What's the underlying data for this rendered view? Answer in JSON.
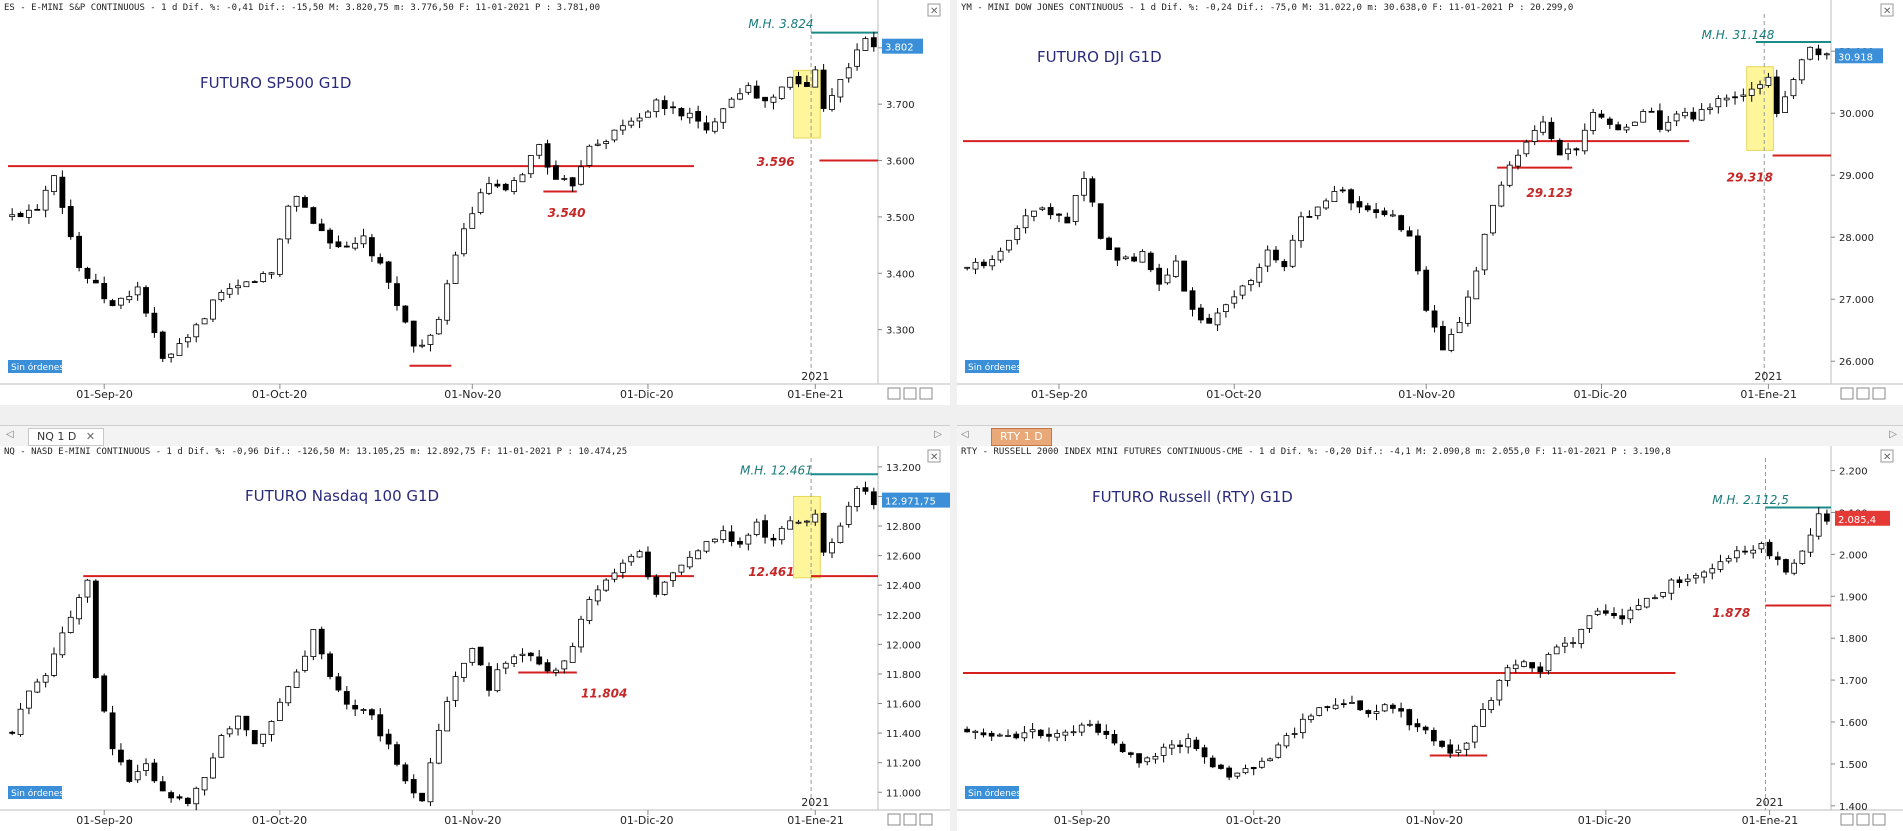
{
  "tabs": {
    "left_tab": "NQ 1 D",
    "right_tab": "RTY 1 D"
  },
  "colors": {
    "up": "#ffffff",
    "down": "#000000",
    "red_line": "#d62020",
    "teal_line": "#1a8a8a",
    "label_red": "#c62828",
    "label_teal": "#1a7a7a",
    "title_blue": "#2a2a7a",
    "price_tag": "#3a8fd8",
    "price_tag_red": "#e53935",
    "highlight": "#fff59a"
  },
  "no_orders_label": "Sin órdenes",
  "chart_data": [
    {
      "id": "sp500",
      "type": "candlestick",
      "header": "ES - E-MINI S&P CONTINUOUS - 1 d Dif. %: -0,41 Dif.: -15,50 M: 3.820,75 m: 3.776,50 F: 11-01-2021 P : 3.781,00",
      "title": "FUTURO SP500 G1D",
      "ylim": [
        3200,
        3860
      ],
      "yticks": [
        3300,
        3400,
        3500,
        3600,
        3700,
        3800
      ],
      "ytick_labels": [
        "3.300",
        "3.400",
        "3.500",
        "3.600",
        "3.700",
        "3.800"
      ],
      "last_price": 3802,
      "last_price_label": "3.802",
      "xlabels": [
        {
          "d": 11,
          "t": "01-Sep-20"
        },
        {
          "d": 32,
          "t": "01-Oct-20"
        },
        {
          "d": 55,
          "t": "01-Nov-20"
        },
        {
          "d": 76,
          "t": "01-Dic-20"
        },
        {
          "d": 96,
          "t": "01-Ene-21"
        }
      ],
      "year_label": {
        "d": 96,
        "t": "2021"
      },
      "n_days": 104,
      "anchors": [
        [
          0,
          3500
        ],
        [
          3,
          3520
        ],
        [
          5,
          3580
        ],
        [
          8,
          3410
        ],
        [
          12,
          3340
        ],
        [
          15,
          3375
        ],
        [
          18,
          3245
        ],
        [
          21,
          3280
        ],
        [
          24,
          3350
        ],
        [
          29,
          3390
        ],
        [
          31,
          3400
        ],
        [
          33,
          3520
        ],
        [
          34,
          3540
        ],
        [
          36,
          3490
        ],
        [
          38,
          3460
        ],
        [
          40,
          3440
        ],
        [
          42,
          3460
        ],
        [
          44,
          3410
        ],
        [
          46,
          3350
        ],
        [
          48,
          3270
        ],
        [
          50,
          3290
        ],
        [
          51,
          3310
        ],
        [
          53,
          3440
        ],
        [
          55,
          3510
        ],
        [
          57,
          3560
        ],
        [
          59,
          3540
        ],
        [
          61,
          3580
        ],
        [
          63,
          3630
        ],
        [
          65,
          3560
        ],
        [
          67,
          3560
        ],
        [
          69,
          3630
        ],
        [
          71,
          3640
        ],
        [
          73,
          3660
        ],
        [
          75,
          3680
        ],
        [
          77,
          3700
        ],
        [
          79,
          3690
        ],
        [
          81,
          3680
        ],
        [
          83,
          3650
        ],
        [
          85,
          3700
        ],
        [
          86,
          3710
        ],
        [
          88,
          3740
        ],
        [
          89,
          3705
        ],
        [
          91,
          3710
        ],
        [
          93,
          3745
        ],
        [
          95,
          3730
        ],
        [
          96,
          3760
        ],
        [
          97,
          3700
        ],
        [
          99,
          3740
        ],
        [
          101,
          3800
        ],
        [
          102,
          3810
        ],
        [
          103,
          3802
        ]
      ],
      "hlines": [
        {
          "y": 3590,
          "from": 0,
          "to": 82,
          "color": "red"
        },
        {
          "y": 3236,
          "from": 48,
          "to": 53,
          "color": "red"
        },
        {
          "y": 3545,
          "from": 64,
          "to": 68,
          "color": "red"
        },
        {
          "y": 3600,
          "from": 97,
          "to": 104,
          "color": "red"
        },
        {
          "y": 3827,
          "from": 96,
          "to": 104,
          "color": "teal"
        }
      ],
      "labels": [
        {
          "t": "M.H. 3.824",
          "d": 88,
          "y": 3835,
          "color": "teal"
        },
        {
          "t": "3.596",
          "d": 89,
          "y": 3590,
          "color": "red"
        },
        {
          "t": "3.540",
          "d": 64,
          "y": 3500,
          "color": "red"
        }
      ],
      "highlight": {
        "from": 94,
        "to": 96,
        "y0": 3640,
        "y1": 3760
      },
      "dashed_x": 95.5
    },
    {
      "id": "dji",
      "type": "candlestick",
      "header": "YM - MINI DOW JONES CONTINUOUS - 1 d Dif. %: -0,24 Dif.: -75,0 M: 31.022,0 m: 30.638,0 F: 11-01-2021 P : 20.299,0",
      "title": "FUTURO DJI G1D",
      "ylim": [
        25600,
        31600
      ],
      "yticks": [
        26000,
        27000,
        28000,
        29000,
        30000,
        31000
      ],
      "ytick_labels": [
        "26.000",
        "27.000",
        "28.000",
        "29.000",
        "30.000",
        "31.000"
      ],
      "last_price": 30918,
      "last_price_label": "30.918",
      "xlabels": [
        {
          "d": 11,
          "t": "01-Sep-20"
        },
        {
          "d": 32,
          "t": "01-Oct-20"
        },
        {
          "d": 55,
          "t": "01-Nov-20"
        },
        {
          "d": 76,
          "t": "01-Dic-20"
        },
        {
          "d": 96,
          "t": "01-Ene-21"
        }
      ],
      "year_label": {
        "d": 96,
        "t": "2021"
      },
      "n_days": 104,
      "anchors": [
        [
          0,
          27500
        ],
        [
          3,
          27600
        ],
        [
          6,
          28200
        ],
        [
          9,
          28500
        ],
        [
          12,
          28300
        ],
        [
          14,
          29000
        ],
        [
          16,
          28000
        ],
        [
          18,
          27600
        ],
        [
          21,
          27700
        ],
        [
          23,
          27200
        ],
        [
          25,
          27600
        ],
        [
          27,
          26800
        ],
        [
          29,
          26600
        ],
        [
          32,
          27100
        ],
        [
          34,
          27300
        ],
        [
          36,
          27800
        ],
        [
          38,
          27500
        ],
        [
          40,
          28300
        ],
        [
          42,
          28500
        ],
        [
          44,
          28800
        ],
        [
          46,
          28600
        ],
        [
          48,
          28400
        ],
        [
          51,
          28300
        ],
        [
          53,
          28000
        ],
        [
          55,
          26800
        ],
        [
          57,
          26200
        ],
        [
          59,
          26700
        ],
        [
          61,
          27500
        ],
        [
          63,
          28500
        ],
        [
          65,
          29100
        ],
        [
          67,
          29500
        ],
        [
          69,
          29800
        ],
        [
          71,
          29300
        ],
        [
          73,
          29400
        ],
        [
          75,
          30000
        ],
        [
          77,
          29800
        ],
        [
          79,
          29700
        ],
        [
          81,
          30100
        ],
        [
          83,
          29800
        ],
        [
          85,
          30000
        ],
        [
          87,
          29900
        ],
        [
          89,
          30100
        ],
        [
          91,
          30300
        ],
        [
          93,
          30300
        ],
        [
          95,
          30400
        ],
        [
          96,
          30600
        ],
        [
          97,
          30000
        ],
        [
          99,
          30600
        ],
        [
          101,
          31000
        ],
        [
          103,
          30918
        ]
      ],
      "hlines": [
        {
          "y": 29550,
          "from": 0,
          "to": 87,
          "color": "red"
        },
        {
          "y": 29123,
          "from": 64,
          "to": 73,
          "color": "red"
        },
        {
          "y": 29318,
          "from": 97,
          "to": 104,
          "color": "red"
        },
        {
          "y": 31148,
          "from": 95,
          "to": 104,
          "color": "teal"
        }
      ],
      "labels": [
        {
          "t": "M.H. 31.148",
          "d": 88,
          "y": 31200,
          "color": "teal"
        },
        {
          "t": "29.123",
          "d": 67,
          "y": 28650,
          "color": "red"
        },
        {
          "t": "29.318",
          "d": 91,
          "y": 28900,
          "color": "red"
        }
      ],
      "highlight": {
        "from": 94,
        "to": 96,
        "y0": 29400,
        "y1": 30750
      },
      "dashed_x": 95.5
    },
    {
      "id": "nasdaq",
      "type": "candlestick",
      "header": "NQ - NASD E-MINI CONTINUOUS - 1 d Dif. %: -0,96 Dif.: -126,50 M: 13.105,25 m: 12.892,75 F: 11-01-2021 P : 10.474,25",
      "title": "FUTURO Nasdaq 100 G1D",
      "ylim": [
        10880,
        13260
      ],
      "yticks": [
        11000,
        11200,
        11400,
        11600,
        11800,
        12000,
        12200,
        12400,
        12600,
        12800,
        13000,
        13200
      ],
      "ytick_labels": [
        "11.000",
        "11.200",
        "11.400",
        "11.600",
        "11.800",
        "12.000",
        "12.200",
        "12.400",
        "12.600",
        "12.800",
        "13.000",
        "13.200"
      ],
      "last_price": 12972,
      "last_price_label": "12.971,75",
      "xlabels": [
        {
          "d": 11,
          "t": "01-Sep-20"
        },
        {
          "d": 32,
          "t": "01-Oct-20"
        },
        {
          "d": 55,
          "t": "01-Nov-20"
        },
        {
          "d": 76,
          "t": "01-Dic-20"
        },
        {
          "d": 96,
          "t": "01-Ene-21"
        }
      ],
      "year_label": {
        "d": 96,
        "t": "2021"
      },
      "n_days": 104,
      "anchors": [
        [
          0,
          11400
        ],
        [
          2,
          11700
        ],
        [
          4,
          11800
        ],
        [
          6,
          12100
        ],
        [
          8,
          12300
        ],
        [
          9,
          12450
        ],
        [
          10,
          11800
        ],
        [
          12,
          11300
        ],
        [
          14,
          11100
        ],
        [
          16,
          11200
        ],
        [
          18,
          11000
        ],
        [
          21,
          10950
        ],
        [
          23,
          11100
        ],
        [
          25,
          11400
        ],
        [
          27,
          11500
        ],
        [
          29,
          11300
        ],
        [
          31,
          11500
        ],
        [
          33,
          11700
        ],
        [
          35,
          11900
        ],
        [
          36,
          12100
        ],
        [
          38,
          11800
        ],
        [
          40,
          11600
        ],
        [
          43,
          11500
        ],
        [
          45,
          11300
        ],
        [
          47,
          11100
        ],
        [
          49,
          10950
        ],
        [
          51,
          11400
        ],
        [
          53,
          11800
        ],
        [
          55,
          12000
        ],
        [
          57,
          11700
        ],
        [
          59,
          11900
        ],
        [
          61,
          11950
        ],
        [
          63,
          11850
        ],
        [
          65,
          11800
        ],
        [
          67,
          12000
        ],
        [
          69,
          12300
        ],
        [
          71,
          12450
        ],
        [
          73,
          12550
        ],
        [
          75,
          12600
        ],
        [
          77,
          12350
        ],
        [
          79,
          12500
        ],
        [
          81,
          12600
        ],
        [
          83,
          12700
        ],
        [
          85,
          12750
        ],
        [
          87,
          12650
        ],
        [
          89,
          12800
        ],
        [
          91,
          12700
        ],
        [
          93,
          12850
        ],
        [
          95,
          12850
        ],
        [
          96,
          12900
        ],
        [
          97,
          12600
        ],
        [
          99,
          12800
        ],
        [
          101,
          13050
        ],
        [
          103,
          12972
        ]
      ],
      "hlines": [
        {
          "y": 12461,
          "from": 9,
          "to": 82,
          "color": "red"
        },
        {
          "y": 11810,
          "from": 61,
          "to": 68,
          "color": "red"
        },
        {
          "y": 12461,
          "from": 96,
          "to": 104,
          "color": "red"
        },
        {
          "y": 13150,
          "from": 96,
          "to": 104,
          "color": "teal"
        }
      ],
      "labels": [
        {
          "t": "M.H. 12.461",
          "d": 87,
          "y": 13150,
          "color": "teal"
        },
        {
          "t": "11.804",
          "d": 68,
          "y": 11640,
          "color": "red"
        },
        {
          "t": "12.461",
          "d": 88,
          "y": 12461,
          "color": "red"
        }
      ],
      "highlight": {
        "from": 94,
        "to": 96,
        "y0": 12450,
        "y1": 13000
      },
      "dashed_x": 95.5
    },
    {
      "id": "russell",
      "type": "candlestick",
      "header": "RTY - RUSSELL 2000 INDEX MINI FUTURES CONTINUOUS-CME - 1 d Dif. %: -0,20 Dif.: -4,1 M: 2.090,8 m: 2.055,0 F: 11-01-2021 P : 3.190,8",
      "title": "FUTURO Russell (RTY) G1D",
      "ylim": [
        1390,
        2230
      ],
      "yticks": [
        1400,
        1500,
        1600,
        1700,
        1800,
        1900,
        2000,
        2100,
        2200
      ],
      "ytick_labels": [
        "1.400",
        "1.500",
        "1.600",
        "1.700",
        "1.800",
        "1.900",
        "2.000",
        "2.100",
        "2.200"
      ],
      "last_price": 2085,
      "last_price_label": "2.085,4",
      "xlabels": [
        {
          "d": 14,
          "t": "01-Sep-20"
        },
        {
          "d": 35,
          "t": "01-Oct-20"
        },
        {
          "d": 57,
          "t": "01-Nov-20"
        },
        {
          "d": 78,
          "t": "01-Dic-20"
        },
        {
          "d": 98,
          "t": "01-Ene-21"
        }
      ],
      "year_label": {
        "d": 98,
        "t": "2021"
      },
      "n_days": 106,
      "anchors": [
        [
          0,
          1580
        ],
        [
          3,
          1575
        ],
        [
          6,
          1570
        ],
        [
          9,
          1575
        ],
        [
          12,
          1570
        ],
        [
          15,
          1590
        ],
        [
          17,
          1565
        ],
        [
          19,
          1530
        ],
        [
          21,
          1510
        ],
        [
          24,
          1530
        ],
        [
          27,
          1555
        ],
        [
          29,
          1520
        ],
        [
          31,
          1480
        ],
        [
          33,
          1470
        ],
        [
          35,
          1490
        ],
        [
          37,
          1520
        ],
        [
          39,
          1560
        ],
        [
          41,
          1600
        ],
        [
          43,
          1630
        ],
        [
          45,
          1650
        ],
        [
          47,
          1640
        ],
        [
          49,
          1630
        ],
        [
          52,
          1640
        ],
        [
          54,
          1600
        ],
        [
          56,
          1580
        ],
        [
          58,
          1540
        ],
        [
          60,
          1530
        ],
        [
          62,
          1580
        ],
        [
          64,
          1660
        ],
        [
          66,
          1720
        ],
        [
          68,
          1740
        ],
        [
          70,
          1730
        ],
        [
          72,
          1780
        ],
        [
          74,
          1800
        ],
        [
          76,
          1850
        ],
        [
          78,
          1860
        ],
        [
          80,
          1850
        ],
        [
          82,
          1880
        ],
        [
          84,
          1900
        ],
        [
          86,
          1930
        ],
        [
          88,
          1940
        ],
        [
          90,
          1960
        ],
        [
          92,
          1990
        ],
        [
          94,
          2010
        ],
        [
          96,
          2000
        ],
        [
          97,
          2030
        ],
        [
          98,
          2000
        ],
        [
          100,
          1960
        ],
        [
          102,
          2010
        ],
        [
          104,
          2090
        ],
        [
          105,
          2085
        ]
      ],
      "hlines": [
        {
          "y": 1717,
          "from": 0,
          "to": 87,
          "color": "red"
        },
        {
          "y": 1520,
          "from": 57,
          "to": 64,
          "color": "red"
        },
        {
          "y": 1878,
          "from": 98,
          "to": 106,
          "color": "red"
        },
        {
          "y": 2112,
          "from": 98,
          "to": 106,
          "color": "teal"
        }
      ],
      "labels": [
        {
          "t": "M.H. 2.112,5",
          "d": 91,
          "y": 2120,
          "color": "teal"
        },
        {
          "t": "1.878",
          "d": 91,
          "y": 1850,
          "color": "red"
        }
      ],
      "highlight": null,
      "dashed_x": 97.5
    }
  ]
}
